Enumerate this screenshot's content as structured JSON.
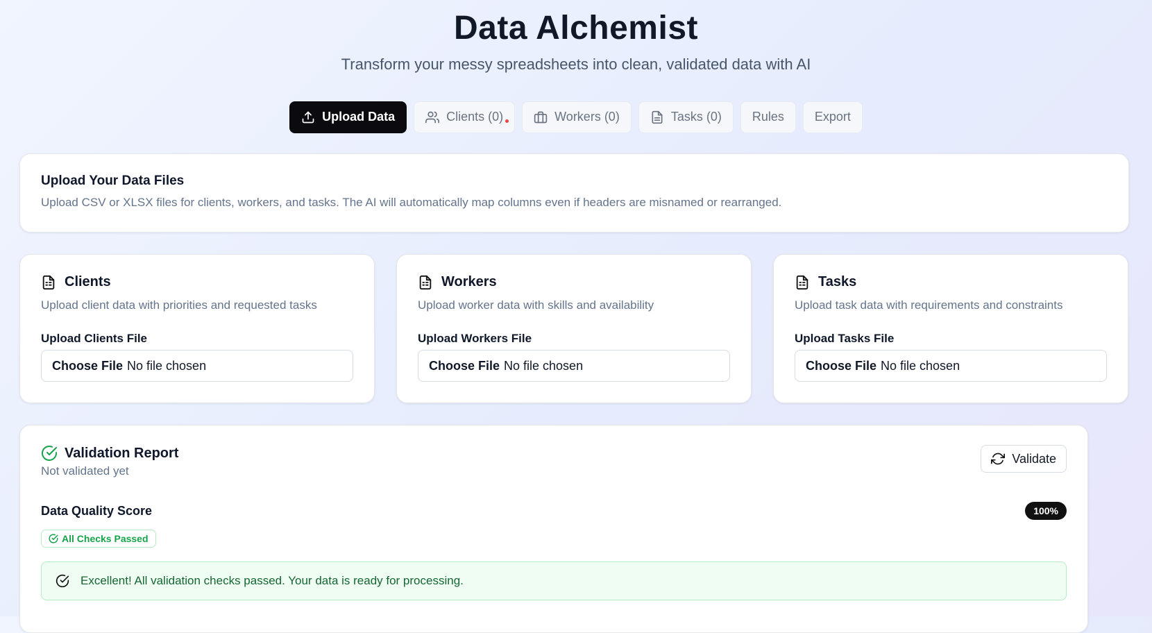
{
  "header": {
    "title": "Data Alchemist",
    "subtitle": "Transform your messy spreadsheets into clean, validated data with AI"
  },
  "tabs": [
    {
      "label": "Upload Data",
      "icon": "upload-icon",
      "active": true
    },
    {
      "label": "Clients (0)",
      "icon": "users-icon",
      "active": false
    },
    {
      "label": "Workers (0)",
      "icon": "briefcase-icon",
      "active": false
    },
    {
      "label": "Tasks (0)",
      "icon": "file-text-icon",
      "active": false
    },
    {
      "label": "Rules",
      "active": false
    },
    {
      "label": "Export",
      "active": false
    }
  ],
  "intro": {
    "title": "Upload Your Data Files",
    "description": "Upload CSV or XLSX files for clients, workers, and tasks. The AI will automatically map columns even if headers are misnamed or rearranged."
  },
  "uploads": [
    {
      "title": "Clients",
      "description": "Upload client data with priorities and requested tasks",
      "label": "Upload Clients File",
      "button": "Choose File",
      "status": "No file chosen",
      "icon": "file-sheet-icon"
    },
    {
      "title": "Workers",
      "description": "Upload worker data with skills and availability",
      "label": "Upload Workers File",
      "button": "Choose File",
      "status": "No file chosen",
      "icon": "file-sheet-icon"
    },
    {
      "title": "Tasks",
      "description": "Upload task data with requirements and constraints",
      "label": "Upload Tasks File",
      "button": "Choose File",
      "status": "No file chosen",
      "icon": "file-sheet-icon"
    }
  ],
  "validation": {
    "title": "Validation Report",
    "subtitle": "Not validated yet",
    "validate_button": "Validate",
    "score_label": "Data Quality Score",
    "score": "100%",
    "checks_badge": "All Checks Passed",
    "message": "Excellent! All validation checks passed. Your data is ready for processing."
  },
  "colors": {
    "accent_dark": "#0b0b0f",
    "success": "#16a34a",
    "success_bg": "#effdf3",
    "notification_dot": "#ef4444"
  }
}
